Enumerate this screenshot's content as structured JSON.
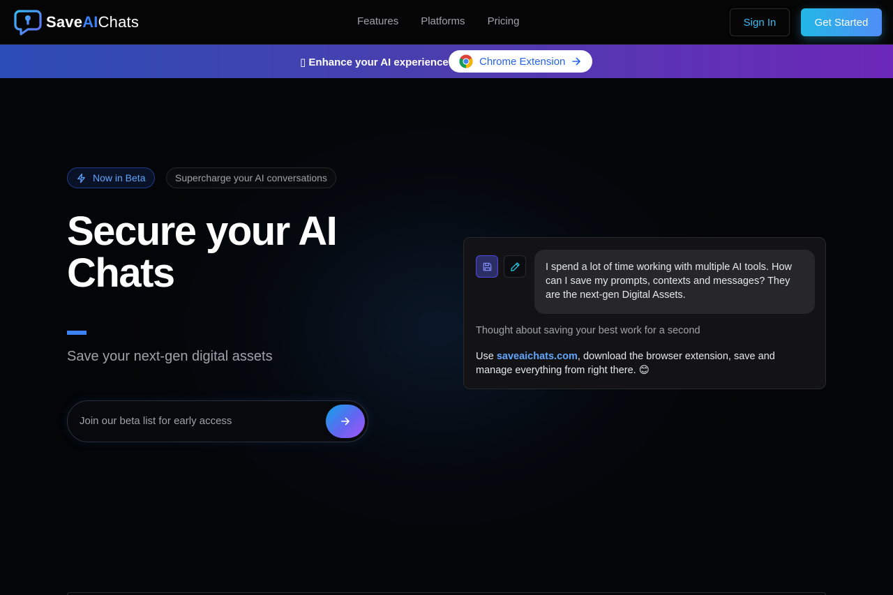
{
  "header": {
    "logo": {
      "part1": "Save",
      "part2": "AI",
      "part3": "Chats"
    },
    "nav": [
      "Features",
      "Platforms",
      "Pricing"
    ],
    "sign_in": "Sign In",
    "get_started": "Get Started"
  },
  "banner": {
    "text": "▯ Enhance your AI experience",
    "button_label": "Chrome Extension"
  },
  "hero": {
    "badge_beta": "Now in Beta",
    "badge_tagline": "Supercharge your AI conversations",
    "title": "Secure your AI Chats",
    "subtitle": "Save your next-gen digital assets",
    "form": {
      "placeholder": "Join our beta list for early access"
    }
  },
  "chat": {
    "user_message": "I spend a lot of time working with multiple AI tools. How can I save my prompts, contexts and messages? They are the next-gen Digital Assets.",
    "thought": "Thought about saving your best work for a second",
    "answer_prefix": "Use ",
    "answer_link": "saveaichats.com",
    "answer_suffix": ", download the browser extension, save and manage everything from right there. 😊"
  },
  "colors": {
    "accent": "#3b82f6",
    "cyan": "#38bdf8",
    "banner_start": "#2c4db5",
    "banner_end": "#6d28b9",
    "background": "#030507"
  },
  "icons": {
    "logo": "lock-chat-icon",
    "chrome": "chrome-icon",
    "arrow": "arrow-right-icon",
    "beta": "lightning-icon",
    "save": "floppy-disk-icon",
    "edit": "pencil-icon"
  }
}
